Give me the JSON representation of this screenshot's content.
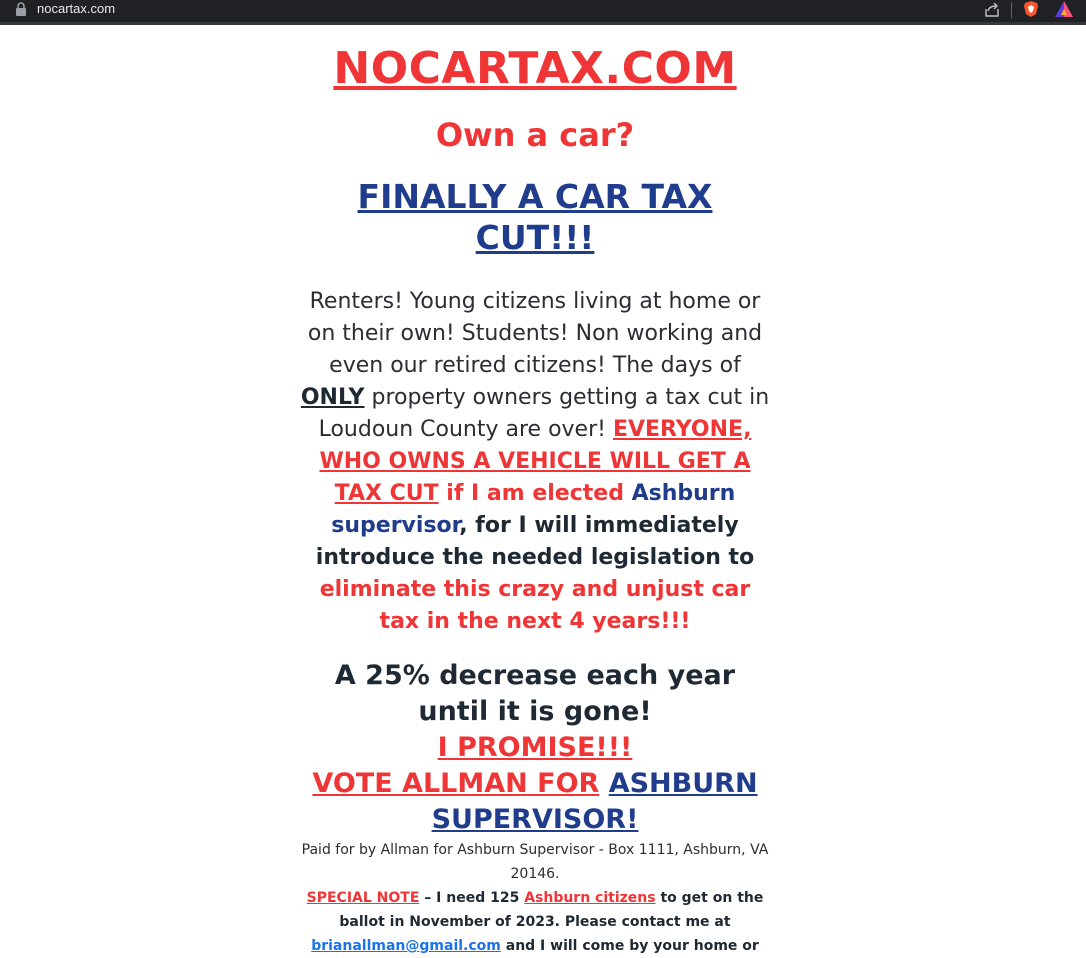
{
  "browser": {
    "url": "nocartax.com",
    "lock_icon": "lock-icon",
    "share_icon": "share-icon",
    "brave_icon": "brave-shield-icon",
    "rewards_icon": "brave-rewards-icon"
  },
  "page": {
    "site_title": "NOCARTAX.COM",
    "question": "Own a car?",
    "headline": "FINALLY A CAR TAX CUT!!!",
    "body": {
      "p1": "Renters! Young citizens living at home or on their own! Students! Non working and even our retired citizens! The days of ",
      "only": "ONLY",
      "p2": " property owners getting a tax cut in Loudoun County are over! ",
      "everyone_link": "EVERYONE, WHO OWNS A VEHICLE WILL GET A TAX CUT",
      "if_elected": " if I am elected ",
      "supervisor_link": "Ashburn supervisor",
      "legislation": ", for I will immediately introduce the needed legislation to ",
      "eliminate": "eliminate this crazy and unjust car tax in the next 4 years!!!"
    },
    "decrease": "A 25% decrease each year until it is gone!",
    "promise": "I PROMISE!!!",
    "vote_text": "VOTE ALLMAN FOR",
    "vote_link": "ASHBURN SUPERVISOR!",
    "paid_for": "Paid for by Allman for Ashburn Supervisor - Box 1111, Ashburn, VA 20146.",
    "special": {
      "label": "SPECIAL NOTE",
      "text1": " – I need 125 ",
      "citizens_link": "Ashburn citizens",
      "text2": " to get on the ballot in November of 2023. Please contact me at ",
      "email": "brianallman@gmail.com",
      "text3": " and I will come by your home or"
    }
  },
  "colors": {
    "red": "#ef3535",
    "blue": "#203c8c",
    "dark": "#1f2933",
    "topbar": "#202124"
  }
}
